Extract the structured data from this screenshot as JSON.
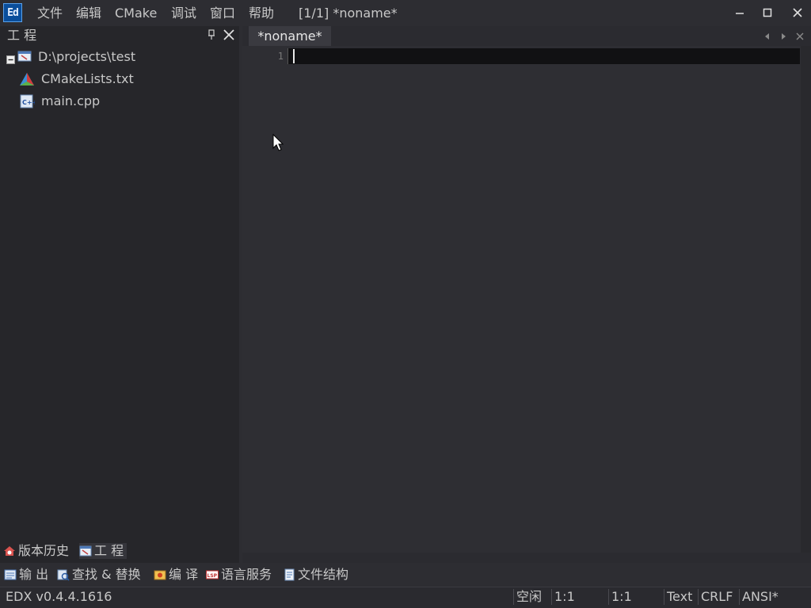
{
  "app": {
    "logo_text": "Ed",
    "window_title": "[1/1] *noname*"
  },
  "menu": [
    "文件",
    "编辑",
    "CMake",
    "调试",
    "窗口",
    "帮助"
  ],
  "sidebar": {
    "title": "工 程",
    "tree": {
      "root": "D:\\projects\\test",
      "children": [
        "CMakeLists.txt",
        "main.cpp"
      ]
    },
    "bottom_tabs": [
      "版本历史",
      "工 程"
    ]
  },
  "editor": {
    "tab_label": "*noname*",
    "line_numbers": [
      "1"
    ]
  },
  "panel_tabs": [
    "输 出",
    "查找 & 替换",
    "编 译",
    "语言服务",
    "文件结构"
  ],
  "status": {
    "version": "EDX v0.4.4.1616",
    "state": "空闲",
    "position1": "1:1",
    "position2": "1:1",
    "language": "Text",
    "line_ending": "CRLF",
    "encoding": "ANSI*"
  },
  "colors": {
    "accent": "#0a4e9b",
    "background": "#2b2b30",
    "editor": "#2e2e33"
  }
}
